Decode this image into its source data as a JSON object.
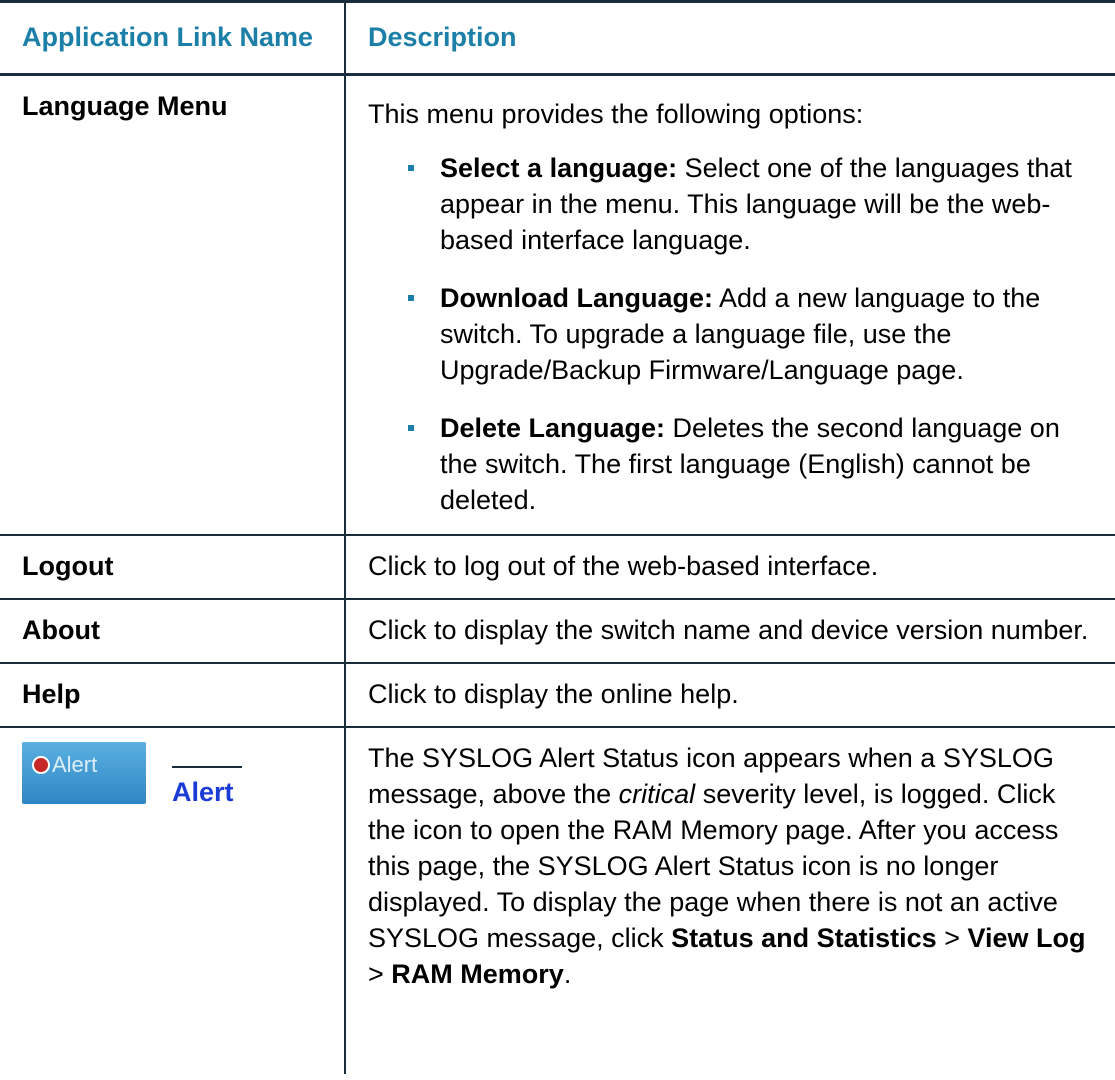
{
  "header": {
    "col1": "Application Link Name",
    "col2": "Description"
  },
  "rows": {
    "language_menu": {
      "name": "Language Menu",
      "intro": "This menu provides the following options:",
      "options": [
        {
          "term": "Select a language:",
          "text": " Select one of the languages that appear in the menu. This language will be the web-based interface language."
        },
        {
          "term": "Download Language:",
          "text": " Add a new language to the switch. To upgrade a language file, use the Upgrade/Backup Firmware/Language page."
        },
        {
          "term": "Delete Language:",
          "text": " Deletes the second language on the switch. The first language (English) cannot be deleted."
        }
      ]
    },
    "logout": {
      "name": "Logout",
      "desc": "Click to log out of the web-based interface."
    },
    "about": {
      "name": "About",
      "desc": "Click to display the switch name and device version number."
    },
    "help": {
      "name": "Help",
      "desc": "Click to display the online help."
    },
    "alert": {
      "icon_text": "Alert",
      "link": "Alert",
      "desc_1": "The SYSLOG Alert Status icon appears when a SYSLOG message, above the ",
      "desc_italic": "critical",
      "desc_2": " severity level, is logged. Click the icon to open the RAM Memory page. After you access this page, the SYSLOG Alert Status icon is no longer displayed. To display the page when there is not an active SYSLOG message, click ",
      "path_1": "Status and Statistics",
      "sep_1": " > ",
      "path_2": "View Log",
      "sep_2": " > ",
      "path_3": "RAM Memory",
      "end": "."
    }
  },
  "colors": {
    "header_text": "#1b7fa7",
    "link": "#1a3bd6",
    "rule": "#1a2d3a",
    "alert_icon_bg": "#2f86c4",
    "alert_badge": "#c62828"
  }
}
